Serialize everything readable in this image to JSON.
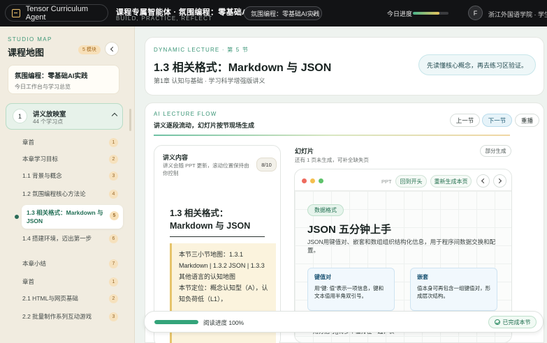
{
  "topbar": {
    "app_name": "Tensor Curriculum Agent",
    "course_title": "课程专属智能体 · 氛围编程：零基础AI实践",
    "course_subtitle": "BUILD, PRACTICE, REFLECT",
    "course_select": "氛围编程：零基础AI实践",
    "progress_label": "今日进度",
    "progress_fraction": 0.75,
    "avatar_initial": "F",
    "user_org": "浙江外国语学院 · 学生"
  },
  "sidebar": {
    "eyebrow": "STUDIO MAP",
    "title": "课程地图",
    "module_count": "5 模块",
    "course_card": {
      "title": "氛围编程：零基础AI实践",
      "subtitle": "今日工作台与学习总览"
    },
    "chapter": {
      "number": "1",
      "name": "讲义放映室",
      "subtitle": "44 个学习点"
    },
    "lessons": [
      {
        "label": "章首",
        "num": "1"
      },
      {
        "label": "本章学习目标",
        "num": "2"
      },
      {
        "label": "1.1 背景与概念",
        "num": "3"
      },
      {
        "label": "1.2 氛围编程核心方法论",
        "num": "4"
      },
      {
        "label": "1.3 相关格式：Markdown 与 JSON",
        "num": "5",
        "active": true
      },
      {
        "label": "1.4 搭建环境，迈出第一步",
        "num": "6"
      },
      {
        "label": "本章小结",
        "num": "7"
      },
      {
        "label": "章首",
        "num": "1"
      },
      {
        "label": "2.1 HTML与网页基础",
        "num": "2"
      },
      {
        "label": "2.2 批量制作系列互动游戏",
        "num": "3"
      }
    ]
  },
  "hero": {
    "eyebrow": "DYNAMIC LECTURE · 第 5 节",
    "title": "1.3 相关格式：Markdown 与 JSON",
    "subtitle": "第1章 认知与基础 · 学习科学增强版讲义",
    "tip": "先读懂核心概念，再去练习区验证。"
  },
  "flow": {
    "eyebrow": "AI LECTURE FLOW",
    "title": "讲义逐段流动，幻灯片按节现场生成",
    "prev": "上一节",
    "next": "下一节",
    "replay": "重播"
  },
  "notes": {
    "title": "讲义内容",
    "subtitle": "讲义会随 PPT 更新，滚动位置保持由你控制",
    "badge": "8/10",
    "heading": "1.3 相关格式：Markdown 与 JSON",
    "body_1": "本节三小节地图：1.3.1 Markdown | 1.3.2 JSON | 1.3.3 其他语言的认知地图",
    "body_2": "本节定位：概念认知型（A），认知负荷低（L1），"
  },
  "slides": {
    "title": "幻灯片",
    "subtitle": "还有 1 页未生成，可补全缺失页",
    "partial": "部分生成",
    "ppt_label": "PPT",
    "to_start": "回到开头",
    "regenerate": "重新生成本页",
    "tag": "数据格式",
    "heading": "JSON 五分钟上手",
    "description": "JSON用键值对、嵌套和数组组织结构化信息，用于程序间数据交换和配置。",
    "card1_title": "键值对",
    "card1_text": "用“键: 值”表示一项信息，键和文本值用半角双引号。",
    "card2_title": "嵌套",
    "card2_text": "值本身可再包含一组键值对，形成层次结构。",
    "bottom_text": "用方括号[]将多个值排在一起，表"
  },
  "reading": {
    "label": "阅读进度 100%",
    "fraction": 1.0,
    "done": "已完成本节"
  }
}
